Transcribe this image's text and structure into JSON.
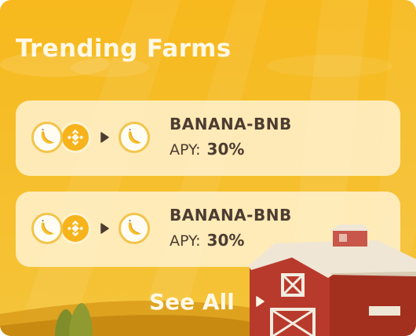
{
  "title": "Trending Farms",
  "farms": [
    {
      "pair": "BANANA-BNB",
      "apy_label": "APY:",
      "apy_value": "30%",
      "tokens": [
        "banana-token-icon",
        "bnb-token-icon"
      ],
      "reward_token": "banana-token-icon"
    },
    {
      "pair": "BANANA-BNB",
      "apy_label": "APY:",
      "apy_value": "30%",
      "tokens": [
        "banana-token-icon",
        "bnb-token-icon"
      ],
      "reward_token": "banana-token-icon"
    }
  ],
  "see_all": {
    "label": "See All",
    "icon": "play-arrow-icon"
  },
  "colors": {
    "background": "#f7b91d",
    "card": "#fff4d6",
    "text": "#4d3c31",
    "barn": "#b83a2c",
    "roof": "#efe6d6"
  }
}
